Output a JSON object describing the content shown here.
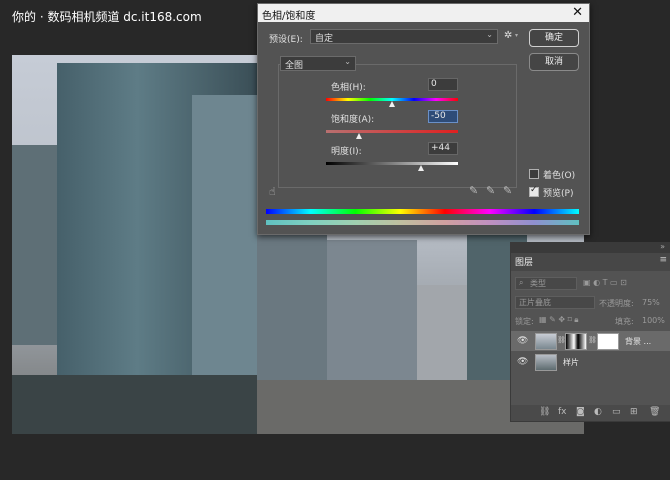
{
  "watermark": "你的 · 数码相机频道 dc.it168.com",
  "dialog": {
    "title": "色相/饱和度",
    "close": "✕",
    "preset_label": "预设(E):",
    "preset_value": "自定",
    "ok": "确定",
    "cancel": "取消",
    "channel": "全图",
    "hue_label": "色相(H):",
    "hue_value": "0",
    "sat_label": "饱和度(A):",
    "sat_value": "-50",
    "light_label": "明度(I):",
    "light_value": "+44",
    "colorize_label": "着色(O)",
    "colorize_checked": false,
    "preview_label": "预览(P)",
    "preview_checked": true,
    "slider_levels": {
      "hue": 0.5,
      "saturation": 0.25,
      "lightness": 0.72
    }
  },
  "layers": {
    "tab": "图层",
    "kind_placeholder": "类型",
    "blend_mode": "正片叠底",
    "opacity_label": "不透明度:",
    "opacity_value": "75%",
    "lock_label": "锁定:",
    "fill_label": "填充:",
    "fill_value": "100%",
    "items": [
      {
        "name": "背景 ...",
        "active": true
      },
      {
        "name": "样片",
        "active": false
      }
    ]
  },
  "icons": [
    "gear-icon",
    "hand-icon",
    "eyedropper-icon",
    "eyedropper-plus-icon",
    "eyedropper-minus-icon",
    "eye-icon",
    "search-icon",
    "link-icon",
    "fx-icon",
    "mask-icon",
    "adjustment-icon",
    "folder-icon",
    "new-layer-icon",
    "trash-icon"
  ]
}
